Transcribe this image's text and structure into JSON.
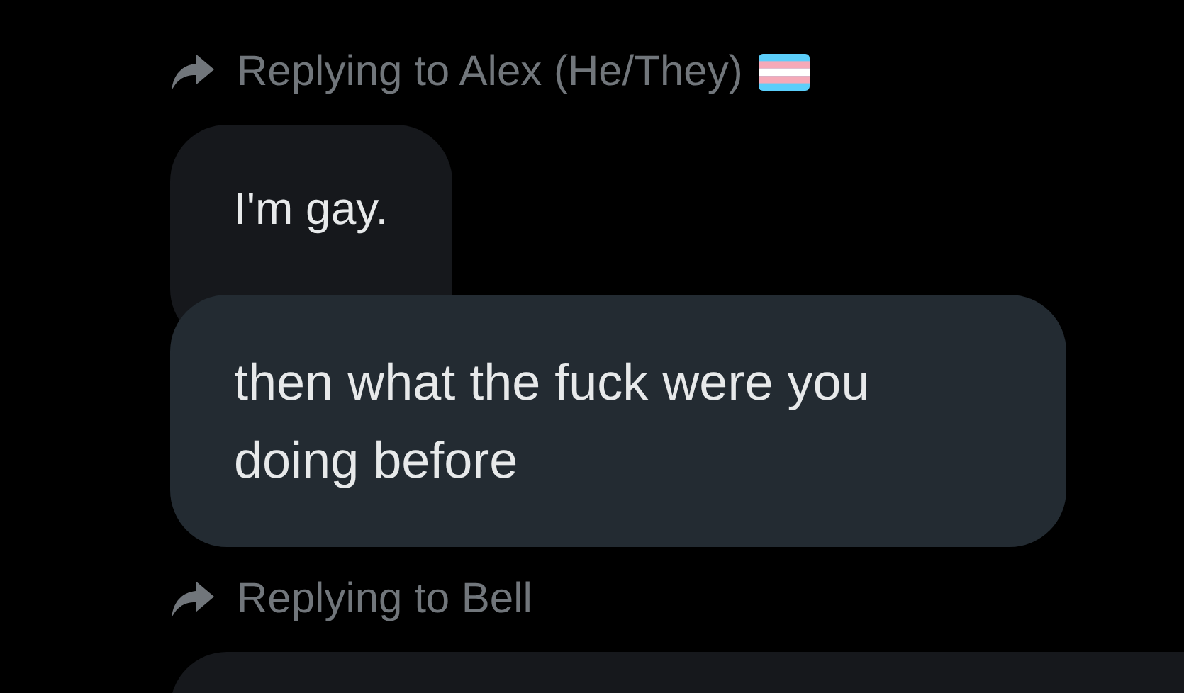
{
  "groups": [
    {
      "reply_label": "Replying to Alex (He/They)",
      "has_flag": true,
      "messages": [
        {
          "text": "I'm gay.",
          "highlighted": false
        },
        {
          "text": "then what the fuck were you doing before",
          "highlighted": true
        }
      ]
    },
    {
      "reply_label": "Replying to Bell",
      "has_flag": false,
      "messages": [
        {
          "highlighted": false
        }
      ]
    }
  ]
}
